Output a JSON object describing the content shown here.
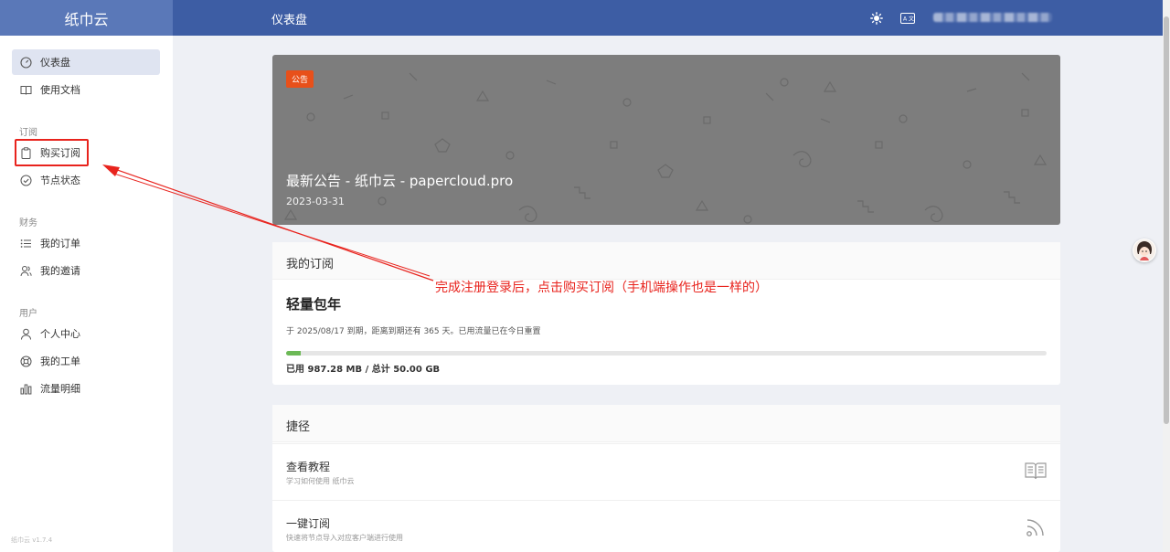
{
  "app": {
    "brand": "纸巾云",
    "page_title": "仪表盘",
    "version": "纸巾云 v1.7.4"
  },
  "header": {
    "theme_icon": "sun-icon",
    "lang_icon": "translate-icon"
  },
  "sidebar": {
    "items_top": [
      {
        "label": "仪表盘",
        "icon": "dashboard-icon",
        "active": true
      },
      {
        "label": "使用文档",
        "icon": "book-icon"
      }
    ],
    "groups": [
      {
        "title": "订阅",
        "items": [
          {
            "label": "购买订阅",
            "icon": "clipboard-icon"
          },
          {
            "label": "节点状态",
            "icon": "check-circle-icon"
          }
        ]
      },
      {
        "title": "财务",
        "items": [
          {
            "label": "我的订单",
            "icon": "list-icon"
          },
          {
            "label": "我的邀请",
            "icon": "users-icon"
          }
        ]
      },
      {
        "title": "用户",
        "items": [
          {
            "label": "个人中心",
            "icon": "user-icon"
          },
          {
            "label": "我的工单",
            "icon": "lifebuoy-icon"
          },
          {
            "label": "流量明细",
            "icon": "bar-chart-icon"
          }
        ]
      }
    ]
  },
  "notice": {
    "tag": "公告",
    "title": "最新公告 - 纸巾云 - papercloud.pro",
    "date": "2023-03-31"
  },
  "subscription": {
    "heading": "我的订阅",
    "plan": "轻量包年",
    "info": "于 2025/08/17 到期，距离到期还有 365 天。已用流量已在今日重置",
    "usage_text": "已用 987.28 MB / 总计 50.00 GB",
    "usage_fraction": 0.0193
  },
  "shortcuts": {
    "heading": "捷径",
    "items": [
      {
        "title": "查看教程",
        "desc": "学习如何使用 纸巾云",
        "icon": "book-open-icon"
      },
      {
        "title": "一键订阅",
        "desc": "快速将节点导入对应客户端进行使用",
        "icon": "rss-icon"
      }
    ]
  },
  "annotation": {
    "text": "完成注册登录后，点击购买订阅（手机端操作也是一样的）",
    "color": "#e8231d"
  },
  "colors": {
    "header": "#3d5da4",
    "brand": "#5a78b8",
    "notice_tag": "#e8501a",
    "progress": "#6cb956"
  }
}
